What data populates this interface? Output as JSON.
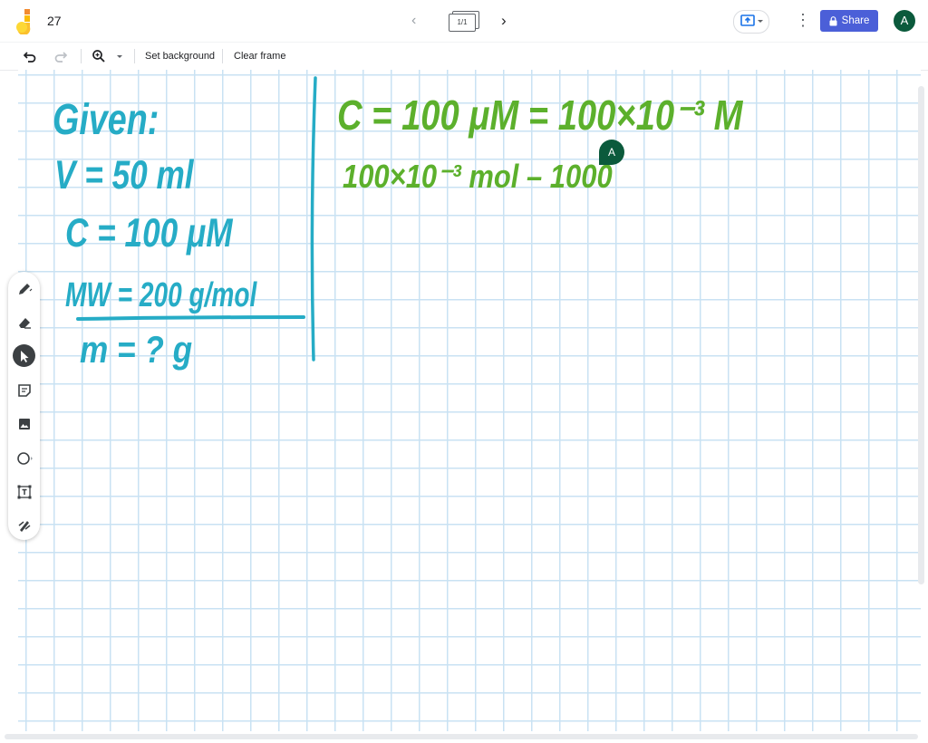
{
  "app": {
    "title": "27",
    "avatar_initial": "A"
  },
  "frames": {
    "indicator": "1/1"
  },
  "header": {
    "share_label": "Share"
  },
  "toolbar": {
    "set_background_label": "Set background",
    "clear_frame_label": "Clear frame"
  },
  "side_tools": [
    "pen-icon",
    "eraser-icon",
    "select-icon",
    "sticky-note-icon",
    "image-icon",
    "circle-icon",
    "text-box-icon",
    "laser-icon"
  ],
  "collaborator": {
    "initial": "A",
    "color": "#0b5a3c"
  },
  "colors": {
    "accent": "#4b5fd8",
    "ink_blue": "#26acc6",
    "ink_green": "#5cb02c",
    "grid": "#c9e2f3"
  },
  "canvas": {
    "given_notes": {
      "heading": "Given:",
      "lines": [
        "V = 50 ml",
        "C = 100 μM",
        "MW = 200 g/mol",
        "m = ? g"
      ]
    },
    "work_notes": {
      "lines": [
        "C = 100 μM = 100×10⁻³ M",
        "100×10⁻³ mol – 1000"
      ]
    }
  }
}
